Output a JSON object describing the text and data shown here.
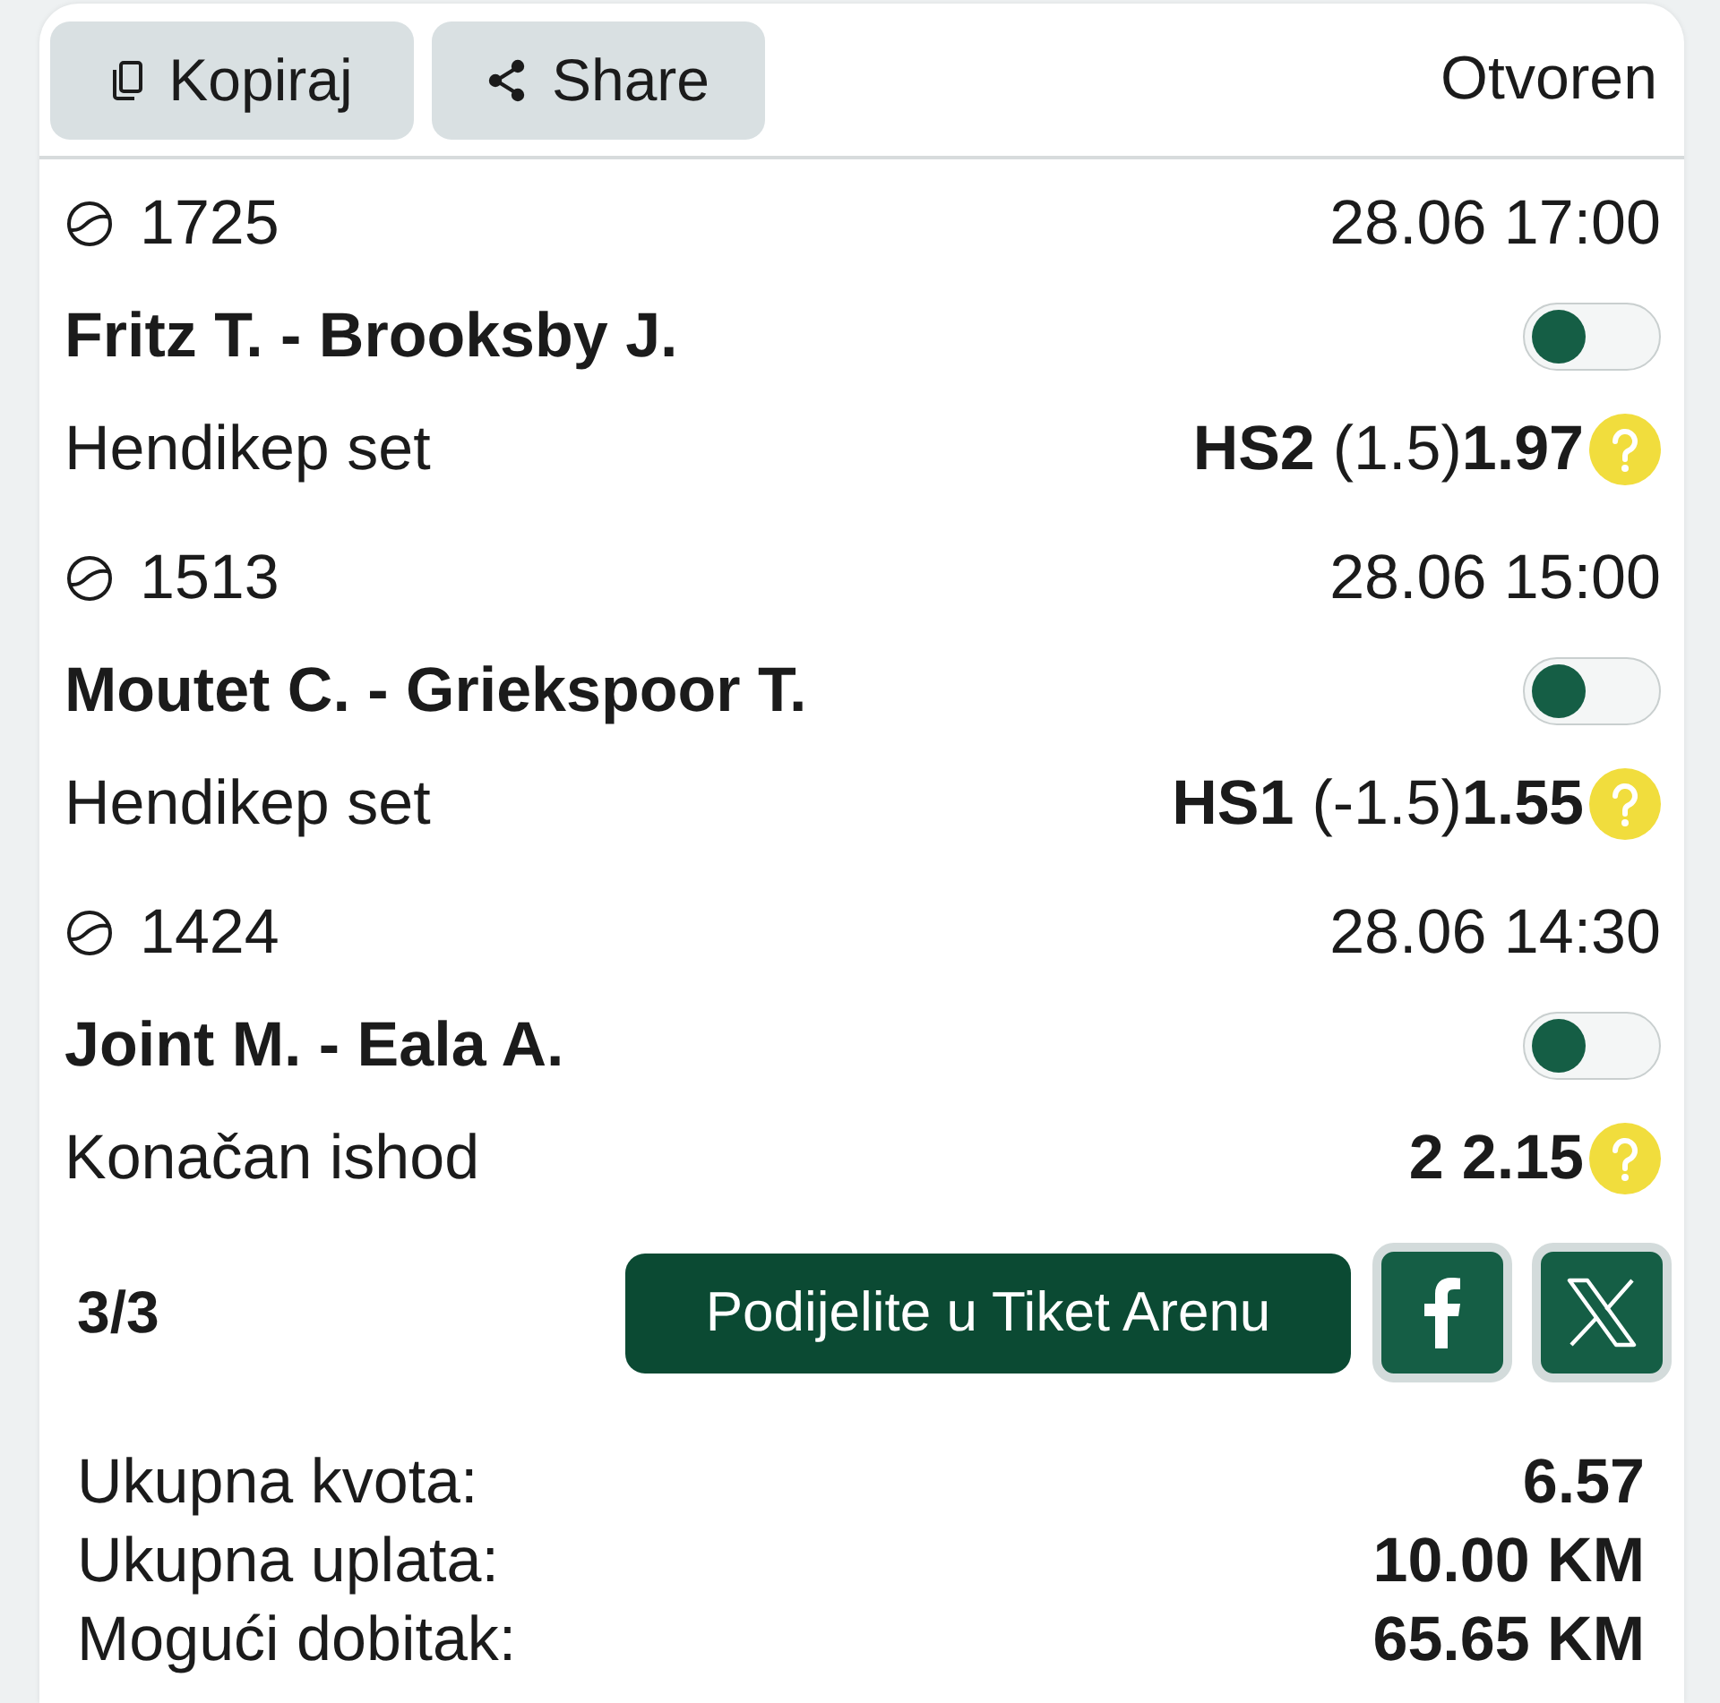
{
  "toolbar": {
    "buttons": [
      {
        "kind": "copy",
        "label": "Kopiraj"
      },
      {
        "kind": "share",
        "label": "Share"
      }
    ],
    "status": "Otvoren"
  },
  "matches": [
    {
      "code": "1725",
      "datetime": "28.06 17:00",
      "teams": "Fritz T. - Brooksby J.",
      "on": false,
      "market": "Hendikep set",
      "pick": "HS2",
      "handicap": "(1.5)",
      "odds": "1.97"
    },
    {
      "code": "1513",
      "datetime": "28.06 15:00",
      "teams": "Moutet C. - Griekspoor T.",
      "on": false,
      "market": "Hendikep set",
      "pick": "HS1",
      "handicap": "(-1.5)",
      "odds": "1.55"
    },
    {
      "code": "1424",
      "datetime": "28.06 14:30",
      "teams": "Joint M. - Eala A.",
      "on": false,
      "market": "Konačan ishod",
      "pick": "2",
      "odds": "2.15"
    }
  ],
  "footer": {
    "count": "3/3",
    "share_button": "Podijelite u Tiket Arenu",
    "social": [
      {
        "kind": "facebook"
      },
      {
        "kind": "x"
      }
    ]
  },
  "totals": [
    {
      "label": "Ukupna kvota:",
      "value": "6.57"
    },
    {
      "label": "Ukupna uplata:",
      "value": "10.00 KM"
    },
    {
      "label": "Mogući dobitak:",
      "value": "65.65 KM"
    }
  ]
}
